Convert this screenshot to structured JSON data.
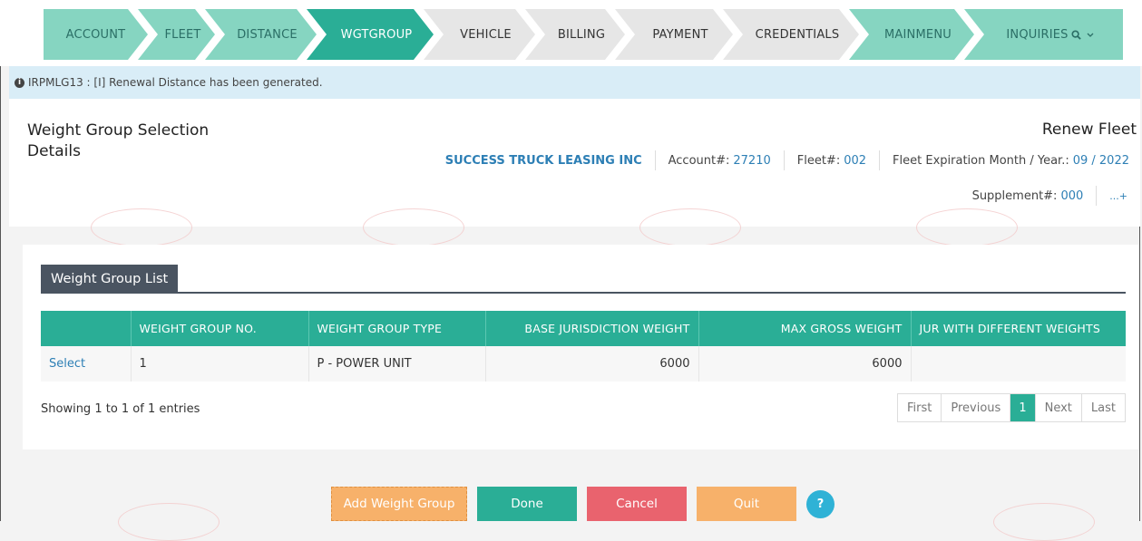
{
  "wizard": {
    "steps": [
      {
        "label": "ACCOUNT",
        "state": "done"
      },
      {
        "label": "FLEET",
        "state": "done"
      },
      {
        "label": "DISTANCE",
        "state": "done"
      },
      {
        "label": "WGTGROUP",
        "state": "active"
      },
      {
        "label": "VEHICLE",
        "state": "todo"
      },
      {
        "label": "BILLING",
        "state": "todo"
      },
      {
        "label": "PAYMENT",
        "state": "todo"
      },
      {
        "label": "CREDENTIALS",
        "state": "todo"
      },
      {
        "label": "MAINMENU",
        "state": "menu"
      },
      {
        "label": "INQUIRIES",
        "state": "menu"
      }
    ],
    "inquiries_icons": [
      "search-icon",
      "chevron-down-icon"
    ]
  },
  "banner": {
    "message": "IRPMLG13 : [I] Renewal Distance has been generated.",
    "icon": "info-icon"
  },
  "header": {
    "title": "Weight Group Selection Details",
    "mode": "Renew Fleet",
    "company": "SUCCESS TRUCK LEASING INC",
    "account_label": "Account#:",
    "account_value": "27210",
    "fleet_label": "Fleet#:",
    "fleet_value": "002",
    "expiration_label": "Fleet Expiration Month / Year.:",
    "expiration_value": "09 / 2022",
    "supplement_label": "Supplement#:",
    "supplement_value": "000",
    "more_label": "...+"
  },
  "list": {
    "tab_label": "Weight Group List",
    "columns": [
      "",
      "WEIGHT GROUP NO.",
      "WEIGHT GROUP TYPE",
      "BASE JURISDICTION WEIGHT",
      "MAX GROSS WEIGHT",
      "JUR WITH DIFFERENT WEIGHTS"
    ],
    "rows": [
      {
        "action": "Select",
        "group_no": "1",
        "group_type": "P - POWER UNIT",
        "base_weight": "6000",
        "max_gross": "6000",
        "jur_diff": ""
      }
    ],
    "showing": "Showing 1 to 1 of 1 entries",
    "pager": {
      "first": "First",
      "previous": "Previous",
      "current": "1",
      "next": "Next",
      "last": "Last"
    }
  },
  "buttons": {
    "add": "Add Weight Group",
    "done": "Done",
    "cancel": "Cancel",
    "quit": "Quit",
    "help": "?"
  },
  "colors": {
    "teal": "#2aae96",
    "teal_light": "#86d5c1",
    "red": "#e9636e",
    "orange": "#f7b16a",
    "link": "#2d7fb5"
  }
}
